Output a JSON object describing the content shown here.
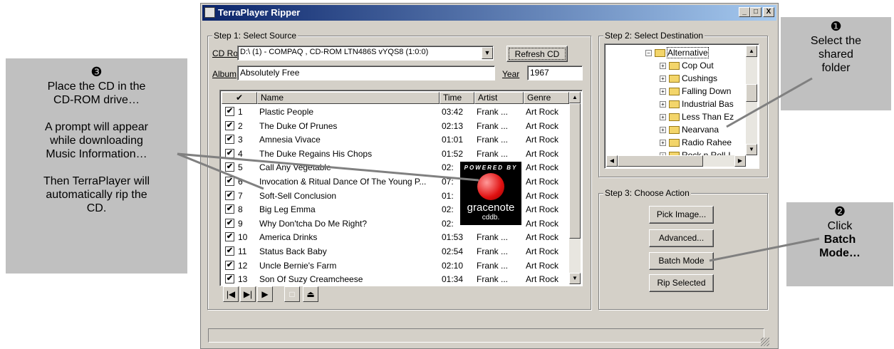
{
  "window": {
    "title": "TerraPlayer Ripper",
    "minimize": "_",
    "maximize": "□",
    "close": "X"
  },
  "step1": {
    "label": "Step 1: Select Source",
    "cdrom_label": "CD Rom",
    "cdrom_value": "D:\\ (1) - COMPAQ  , CD-ROM LTN486S  vYQS8 (1:0:0)",
    "refresh_label": "Refresh CD",
    "album_label": "Album",
    "album_value": "Absolutely Free",
    "year_label": "Year",
    "year_value": "1967"
  },
  "table": {
    "headers": [
      "✔",
      "Name",
      "Time",
      "Artist",
      "Genre"
    ],
    "rows": [
      {
        "n": "1",
        "name": "Plastic People",
        "time": "03:42",
        "artist": "Frank ...",
        "genre": "Art Rock"
      },
      {
        "n": "2",
        "name": "The Duke Of Prunes",
        "time": "02:13",
        "artist": "Frank ...",
        "genre": "Art Rock"
      },
      {
        "n": "3",
        "name": "Amnesia Vivace",
        "time": "01:01",
        "artist": "Frank ...",
        "genre": "Art Rock"
      },
      {
        "n": "4",
        "name": "The Duke Regains His Chops",
        "time": "01:52",
        "artist": "Frank ...",
        "genre": "Art Rock"
      },
      {
        "n": "5",
        "name": "Call Any Vegetable",
        "time": "02:",
        "artist": "",
        "genre": "Art Rock"
      },
      {
        "n": "6",
        "name": "Invocation & Ritual Dance Of The Young P...",
        "time": "07:",
        "artist": "",
        "genre": "Art Rock"
      },
      {
        "n": "7",
        "name": "Soft-Sell Conclusion",
        "time": "01:",
        "artist": "",
        "genre": "Art Rock"
      },
      {
        "n": "8",
        "name": "Big Leg Emma",
        "time": "02:",
        "artist": "",
        "genre": "Art Rock"
      },
      {
        "n": "9",
        "name": "Why Don'tcha Do Me Right?",
        "time": "02:",
        "artist": "",
        "genre": "Art Rock"
      },
      {
        "n": "10",
        "name": "America Drinks",
        "time": "01:53",
        "artist": "Frank ...",
        "genre": "Art Rock"
      },
      {
        "n": "11",
        "name": "Status Back Baby",
        "time": "02:54",
        "artist": "Frank ...",
        "genre": "Art Rock"
      },
      {
        "n": "12",
        "name": "Uncle Bernie's Farm",
        "time": "02:10",
        "artist": "Frank ...",
        "genre": "Art Rock"
      },
      {
        "n": "13",
        "name": "Son Of Suzy Creamcheese",
        "time": "01:34",
        "artist": "Frank ...",
        "genre": "Art Rock"
      }
    ]
  },
  "gracenote": {
    "powered": "POWERED BY",
    "name": "gracenote",
    "sub": "cddb."
  },
  "step2": {
    "label": "Step 2: Select Destination",
    "root": "Alternative",
    "folders": [
      "Cop Out",
      "Cushings",
      "Falling Down",
      "Industrial Bas",
      "Less Than Ez",
      "Nearvana",
      "Radio Rahee",
      "Rock n Roll-L"
    ]
  },
  "step3": {
    "label": "Step 3: Choose Action",
    "pick_image": "Pick Image...",
    "advanced": "Advanced...",
    "batch_mode": "Batch Mode",
    "rip_selected": "Rip Selected"
  },
  "callouts": {
    "left": {
      "num": "❸",
      "line1": "Place the CD in the",
      "line2": "CD-ROM drive…",
      "line3": "A prompt will appear",
      "line4": "while downloading",
      "line5": "Music Information…",
      "line6": "Then TerraPlayer will",
      "line7": "automatically rip the",
      "line8": "CD."
    },
    "top_right": {
      "num": "❶",
      "line1": "Select the",
      "line2": "shared",
      "line3": "folder"
    },
    "bottom_right": {
      "num": "❷",
      "line1": "Click",
      "line2": "Batch",
      "line3": "Mode…"
    }
  }
}
